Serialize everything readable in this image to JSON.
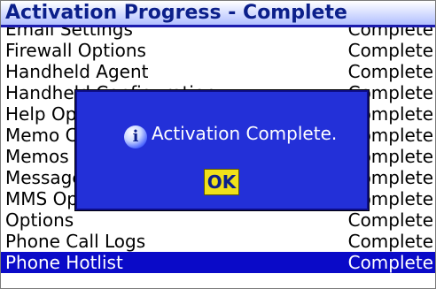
{
  "title": "Activation Progress - Complete",
  "rows": [
    {
      "name": "Email Settings",
      "status": "Complete",
      "partial": true
    },
    {
      "name": "Firewall Options",
      "status": "Complete"
    },
    {
      "name": "Handheld Agent",
      "status": "Complete"
    },
    {
      "name": "Handheld Configuration",
      "status": "Complete"
    },
    {
      "name": "Help Options",
      "status": "Complete"
    },
    {
      "name": "Memo Categories",
      "status": "Complete"
    },
    {
      "name": "Memos",
      "status": "Complete"
    },
    {
      "name": "Message Options",
      "status": "Complete"
    },
    {
      "name": "MMS Options",
      "status": "Complete"
    },
    {
      "name": "Options",
      "status": "Complete"
    },
    {
      "name": "Phone Call Logs",
      "status": "Complete"
    },
    {
      "name": "Phone Hotlist",
      "status": "Complete",
      "selected": true
    }
  ],
  "dialog": {
    "icon": "info-icon",
    "message": "Activation Complete.",
    "ok_label": "OK"
  }
}
